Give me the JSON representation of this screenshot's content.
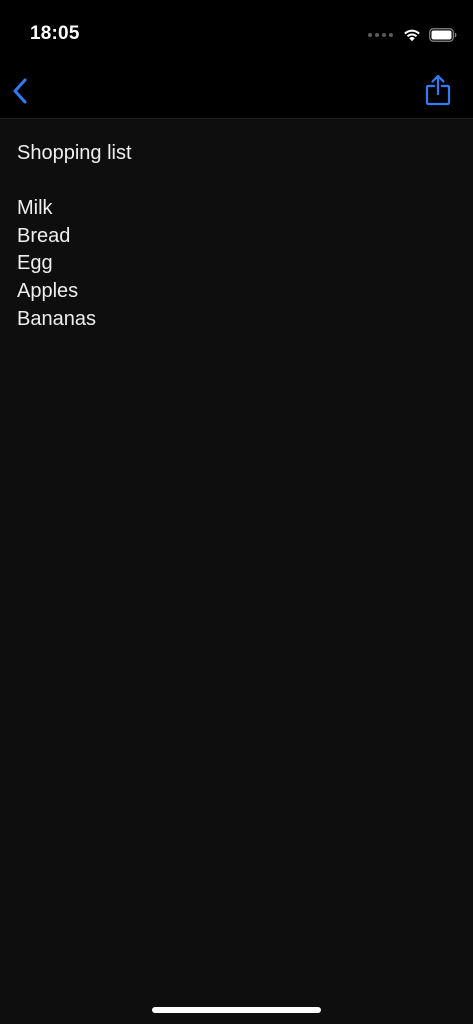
{
  "status_bar": {
    "time": "18:05"
  },
  "nav": {
    "back_icon": "chevron-left-icon",
    "share_icon": "share-icon",
    "accent_color": "#2f7cf6"
  },
  "note": {
    "title": "Shopping list",
    "items": [
      {
        "text": "Milk"
      },
      {
        "text": "Bread"
      },
      {
        "text": "Egg"
      },
      {
        "text": "Apples"
      },
      {
        "text": "Bananas"
      }
    ]
  },
  "colors": {
    "background": "#0e0e0e",
    "bar_background": "#000000",
    "text": "#efefef"
  }
}
